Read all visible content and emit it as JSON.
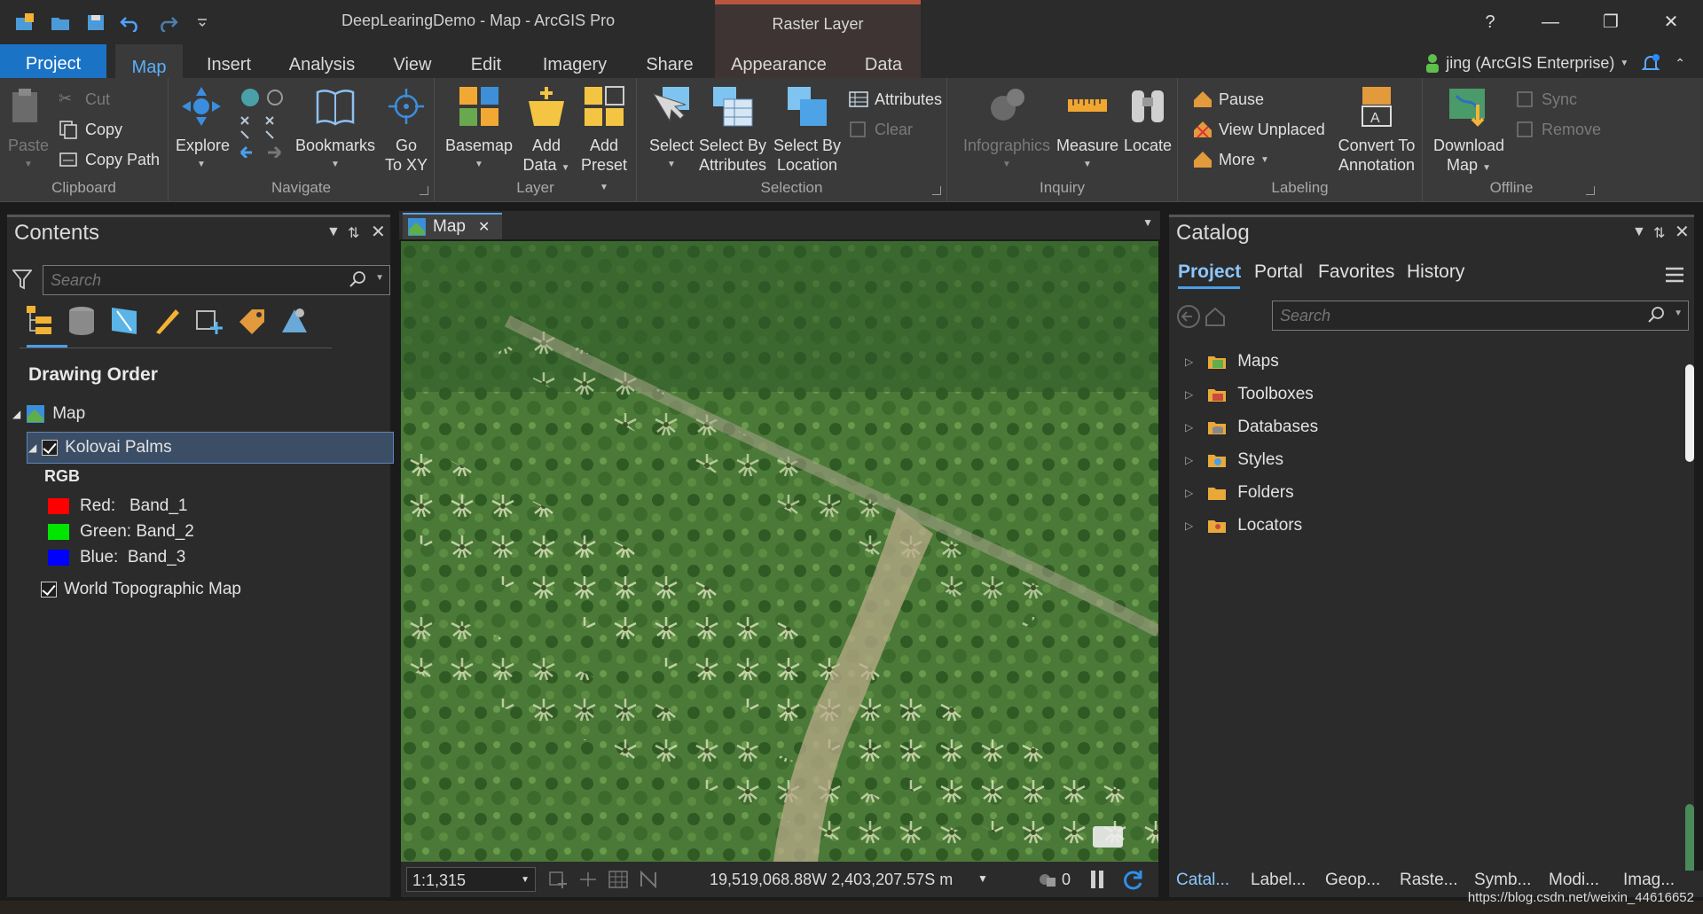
{
  "window": {
    "title": "DeepLearingDemo - Map - ArcGIS Pro",
    "context_tab_group": "Raster Layer",
    "help": "?"
  },
  "quick_access": [
    "new-project-icon",
    "open-project-icon",
    "save-project-icon",
    "undo-icon",
    "redo-icon",
    "customize-icon"
  ],
  "tabs": [
    "Project",
    "Map",
    "Insert",
    "Analysis",
    "View",
    "Edit",
    "Imagery",
    "Share",
    "Appearance",
    "Data"
  ],
  "user": {
    "name": "jing (ArcGIS Enterprise)"
  },
  "ribbon": {
    "clipboard": {
      "label": "Clipboard",
      "paste": "Paste",
      "cut": "Cut",
      "copy": "Copy",
      "copy_path": "Copy Path"
    },
    "navigate": {
      "label": "Navigate",
      "explore": "Explore",
      "bookmarks": "Bookmarks",
      "goto": "Go",
      "goto2": "To XY"
    },
    "layer": {
      "label": "Layer",
      "basemap": "Basemap",
      "add": "Add",
      "data": "Data",
      "add2": "Add",
      "preset": "Preset"
    },
    "selection": {
      "label": "Selection",
      "select": "Select",
      "by_attr1": "Select By",
      "by_attr2": "Attributes",
      "by_loc1": "Select By",
      "by_loc2": "Location",
      "attributes": "Attributes",
      "clear": "Clear"
    },
    "inquiry": {
      "label": "Inquiry",
      "infographics": "Infographics",
      "measure": "Measure",
      "locate": "Locate"
    },
    "labeling": {
      "label": "Labeling",
      "pause": "Pause",
      "view_unplaced": "View Unplaced",
      "more": "More",
      "convert1": "Convert To",
      "convert2": "Annotation"
    },
    "offline": {
      "label": "Offline",
      "download1": "Download",
      "download2": "Map",
      "sync": "Sync",
      "remove": "Remove"
    }
  },
  "contents": {
    "title": "Contents",
    "search_placeholder": "Search",
    "section": "Drawing Order",
    "map_name": "Map",
    "layer": "Kolovai Palms",
    "renderer": "RGB",
    "bands": [
      {
        "label": "Red:   Band_1",
        "color": "#ff0000"
      },
      {
        "label": "Green: Band_2",
        "color": "#00e600"
      },
      {
        "label": "Blue:  Band_3",
        "color": "#0000ff"
      }
    ],
    "basemap_layer": "World Topographic Map"
  },
  "map_view": {
    "tab": "Map",
    "scale": "1:1,315",
    "coordinates": "19,519,068.88W 2,403,207.57S m",
    "pending_count": "0"
  },
  "catalog": {
    "title": "Catalog",
    "tabs": [
      "Project",
      "Portal",
      "Favorites",
      "History"
    ],
    "search_placeholder": "Search",
    "items": [
      "Maps",
      "Toolboxes",
      "Databases",
      "Styles",
      "Folders",
      "Locators"
    ]
  },
  "bottom_tabs": [
    "Catal...",
    "Label...",
    "Geop...",
    "Raste...",
    "Symb...",
    "Modi...",
    "Imag..."
  ],
  "watermark": "https://blog.csdn.net/weixin_44616652"
}
